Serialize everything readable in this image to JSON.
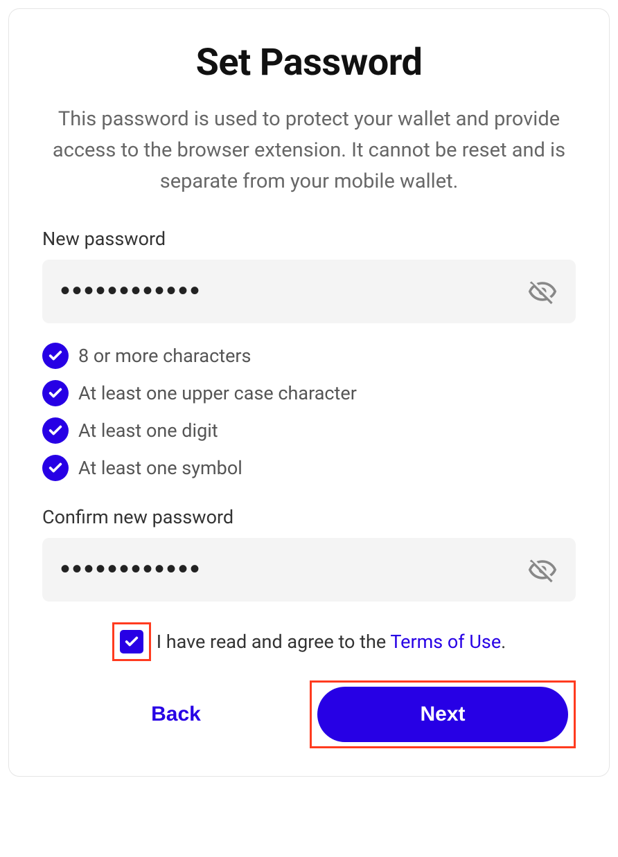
{
  "title": "Set Password",
  "description": "This password is used to protect your wallet and provide access to the browser extension. It cannot be reset and is separate from your mobile wallet.",
  "new_password": {
    "label": "New password",
    "value": "••••••••••••"
  },
  "requirements": [
    "8 or more characters",
    "At least one upper case character",
    "At least one digit",
    "At least one symbol"
  ],
  "confirm_password": {
    "label": "Confirm new password",
    "value": "••••••••••••"
  },
  "terms": {
    "prefix": "I have read and agree to the ",
    "link": "Terms of Use",
    "suffix": "."
  },
  "buttons": {
    "back": "Back",
    "next": "Next"
  },
  "colors": {
    "primary": "#2700e5",
    "highlight": "#ff3b1f"
  }
}
